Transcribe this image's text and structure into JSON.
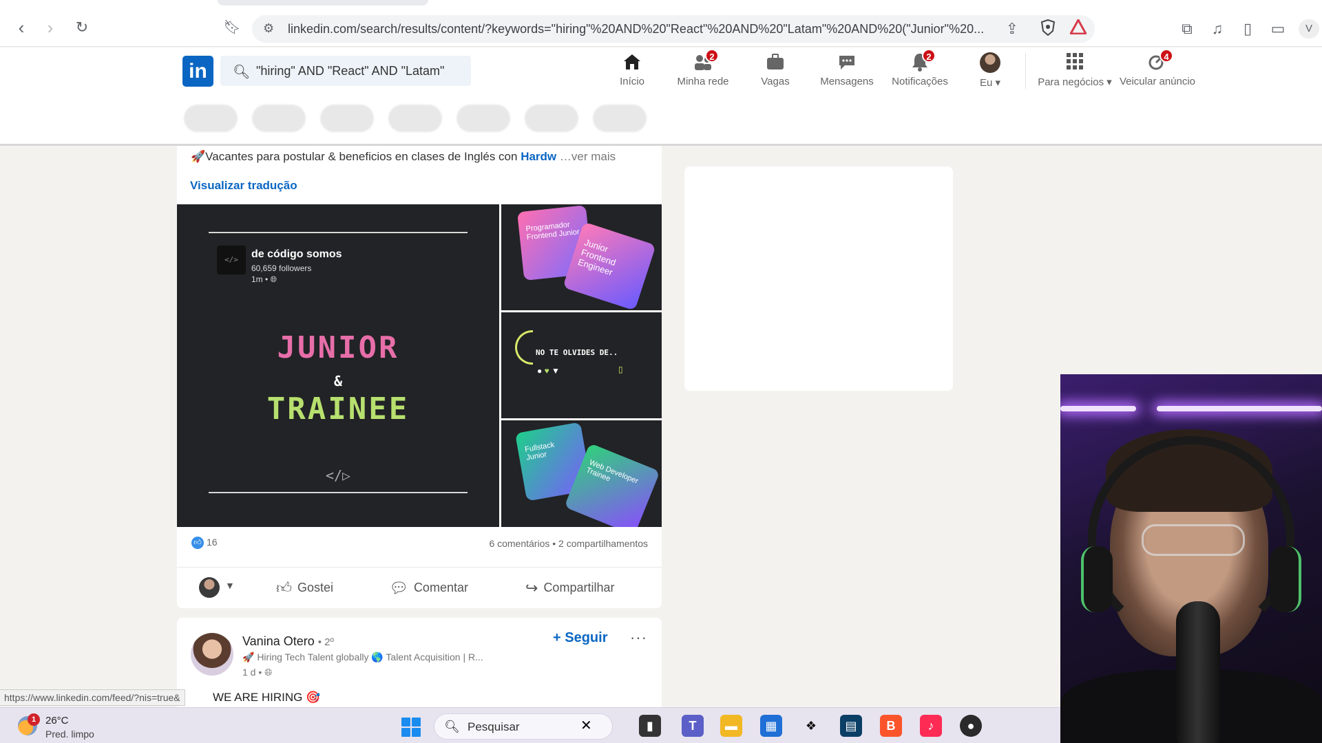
{
  "browser": {
    "url": "linkedin.com/search/results/content/?keywords=\"hiring\"%20AND%20\"React\"%20AND%20\"Latam\"%20AND%20(\"Junior\"%20...",
    "icons": [
      "back-icon",
      "forward-icon",
      "reload-icon",
      "bookmark-icon",
      "tune-icon",
      "share-icon",
      "brave-shield-icon",
      "brave-rewards-icon",
      "extensions-icon",
      "media-icon",
      "sidebar-icon",
      "wallet-icon"
    ],
    "profile_chip": "V"
  },
  "linkedin": {
    "logo": "in",
    "search_value": "\"hiring\" AND \"React\" AND \"Latam\"",
    "nav": [
      {
        "label": "Início",
        "icon": "home-icon",
        "badge": ""
      },
      {
        "label": "Minha rede",
        "icon": "network-icon",
        "badge": "2"
      },
      {
        "label": "Vagas",
        "icon": "briefcase-icon",
        "badge": ""
      },
      {
        "label": "Mensagens",
        "icon": "messaging-icon",
        "badge": ""
      },
      {
        "label": "Notificações",
        "icon": "bell-icon",
        "badge": "2"
      },
      {
        "label": "Eu",
        "icon": "avatar",
        "badge": ""
      },
      {
        "label": "Para negócios",
        "icon": "grid-icon",
        "badge": ""
      },
      {
        "label": "Veicular anúncio",
        "icon": "ad-icon",
        "badge": "4"
      }
    ],
    "accent": "#0a66c2"
  },
  "post": {
    "text_prefix": "🚀Vacantes para postular & beneficios en clases de Inglés con ",
    "mention": "Hardw",
    "see_more": "…ver mais",
    "translate": "Visualizar tradução",
    "image": {
      "account_name": "de código somos",
      "followers": "60,659 followers",
      "time": "1m • ",
      "logo_text": "</>",
      "junior": "JUNIOR",
      "amp": "&",
      "trainee": "TRAINEE",
      "code_glyph": "</▷",
      "card1_a": "Programador Frontend Junior",
      "card1_b": "Junior Frontend Engineer",
      "reminder": "NO TE OLVIDES DE..",
      "card3_a": "Fullstack Junior",
      "card3_b": "Web Developer Trainee"
    },
    "reactions": "16",
    "counts": "6 comentários • 2 compartilhamentos",
    "actions": {
      "like": "Gostei",
      "comment": "Comentar",
      "share": "Compartilhar"
    }
  },
  "post2": {
    "name": "Vanina Otero",
    "degree": "• 2º",
    "headline": "🚀 Hiring Tech Talent globally 🌎 Talent Acquisition | R...",
    "time": "1 d • ",
    "follow": "+ Seguir",
    "more": "···",
    "body": "WE ARE HIRING 🎯"
  },
  "status_url": "https://www.linkedin.com/feed/?nis=true&",
  "taskbar": {
    "weather_badge": "1",
    "temp": "26°C",
    "desc": "Pred. limpo",
    "search_placeholder": "Pesquisar",
    "apps": [
      "windows-start-icon",
      "widgets-icon",
      "file-manager-icon",
      "teams-icon",
      "explorer-icon",
      "store-icon",
      "dropbox-icon",
      "notes-icon",
      "brave-icon",
      "tiktok-icon",
      "obs-icon"
    ]
  }
}
